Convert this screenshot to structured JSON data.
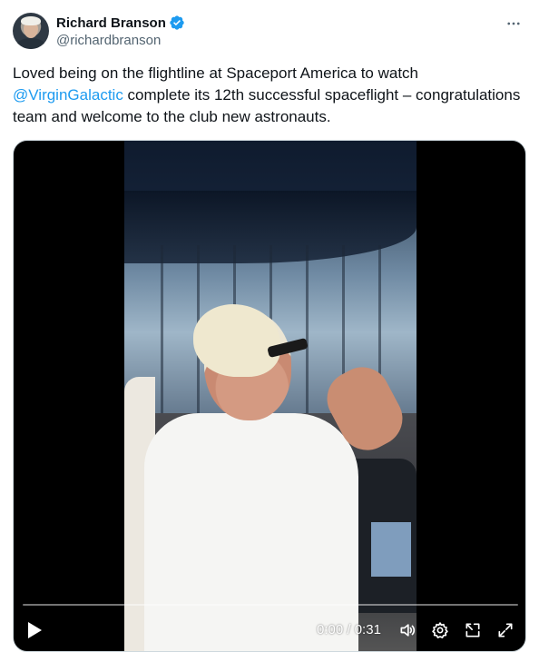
{
  "author": {
    "display_name": "Richard Branson",
    "handle": "@richardbranson",
    "verified": true,
    "avatar_icon": "avatar-photo"
  },
  "more_icon": "more-options-icon",
  "tweet": {
    "text_before_mention": "Loved being on the flightline at Spaceport America to watch ",
    "mention": "@VirginGalactic",
    "text_after_mention": " complete its 12th successful spaceflight – congratulations team and welcome to the club new astronauts."
  },
  "video": {
    "current_time": "0:00",
    "separator": " / ",
    "duration": "0:31",
    "progress": 0.0,
    "controls": {
      "play_icon": "play-icon",
      "volume_icon": "volume-icon",
      "settings_icon": "settings-gear-icon",
      "pip_icon": "picture-in-picture-icon",
      "fullscreen_icon": "fullscreen-icon"
    }
  },
  "colors": {
    "link": "#1d9bf0",
    "verified_badge": "#1d9bf0",
    "text_primary": "#0f1419",
    "text_secondary": "#536471"
  }
}
